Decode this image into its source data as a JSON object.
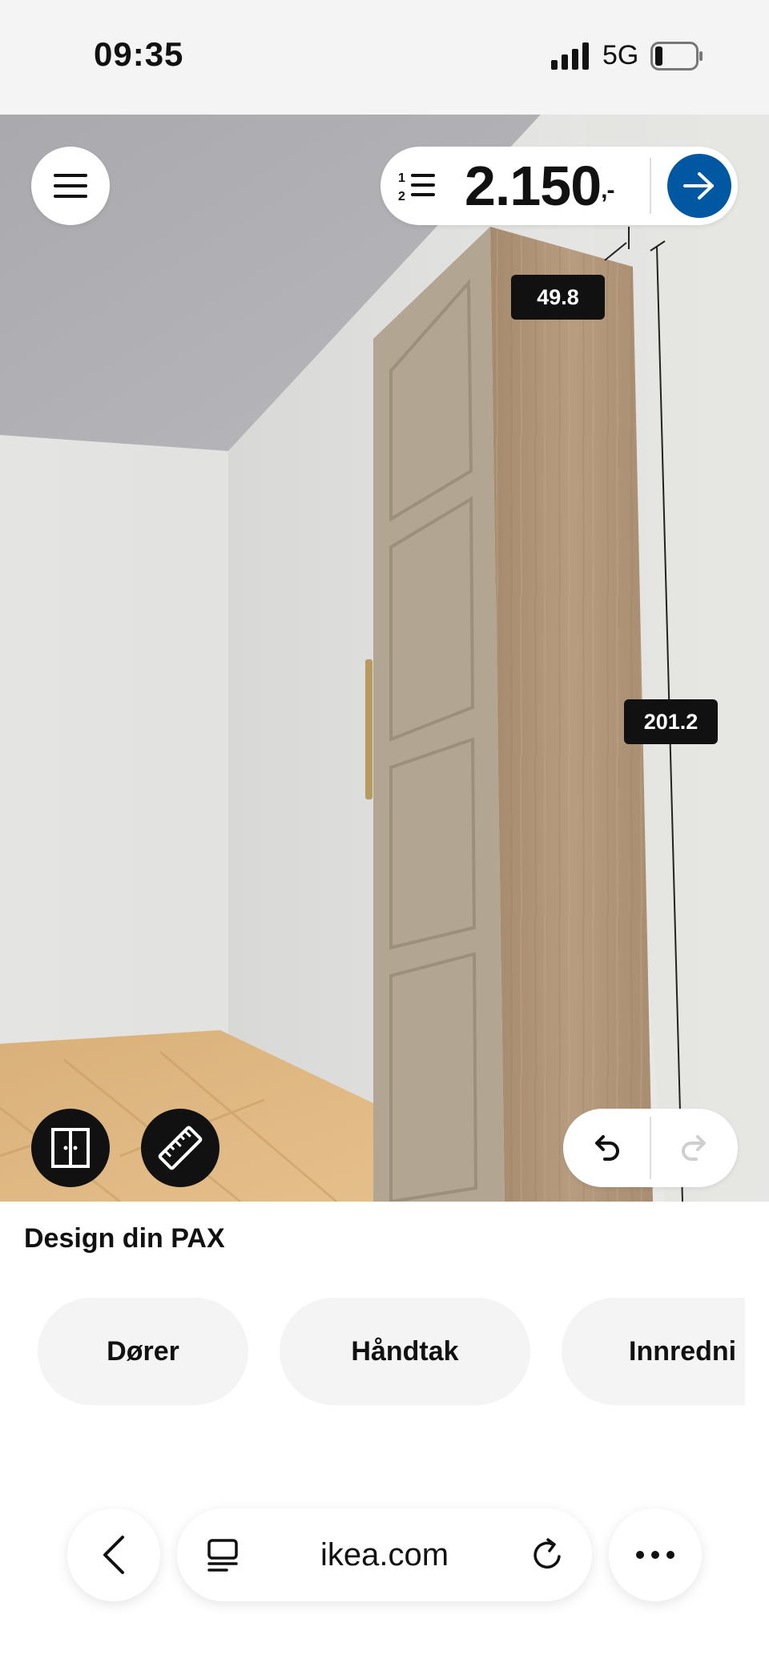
{
  "status_bar": {
    "time": "09:35",
    "network": "5G",
    "icons": [
      "signal-icon",
      "battery-icon"
    ]
  },
  "planner": {
    "price_main": "2.150",
    "price_suffix": ",-",
    "dimensions": {
      "depth": "49.8",
      "height": "201.2"
    },
    "icons": [
      "menu-icon",
      "shopping-list-icon",
      "arrow-right-icon",
      "doors-icon",
      "ruler-icon",
      "undo-icon",
      "redo-icon"
    ],
    "colors": {
      "accent": "#0058a3"
    }
  },
  "panel": {
    "title": "Design din PAX",
    "chips": [
      "Dører",
      "Håndtak",
      "Innredni"
    ]
  },
  "browser": {
    "url": "ikea.com",
    "icons": [
      "chevron-left-icon",
      "tabs-icon",
      "reload-icon",
      "more-icon"
    ]
  }
}
